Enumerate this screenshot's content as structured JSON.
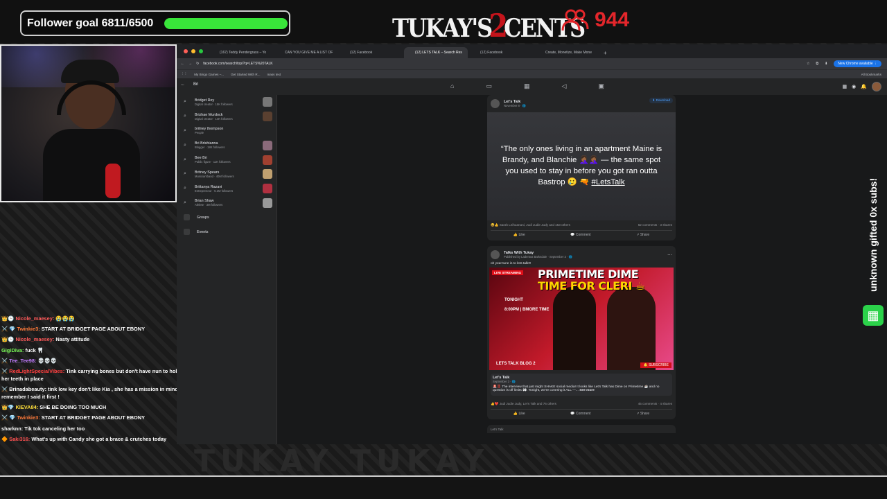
{
  "overlay": {
    "follower_goal_label": "Follower goal 6811/6500",
    "follower_goal_progress": 1.0,
    "logo_part1": "TUKAY'S",
    "logo_two": "2",
    "logo_part2": "CENTS",
    "viewer_count": "944",
    "alert_text": "unknown gifted 0x subs!",
    "bottom_text": "TUKAY TUKAY"
  },
  "chat": [
    {
      "badges": "👑🕒",
      "user": "Nicole_maesey:",
      "user_color": "#ff5a5a",
      "message": "😭😭😭"
    },
    {
      "badges": "⚔️ 💎",
      "user": "Twinkie3:",
      "user_color": "#ff7a3a",
      "message": "START AT BRIDGET PAGE ABOUT EBONY"
    },
    {
      "badges": "👑🕒",
      "user": "Nicole_maesey:",
      "user_color": "#ff5a5a",
      "message": "Nasty attitude"
    },
    {
      "badges": "",
      "user": "GigiDiva:",
      "user_color": "#7cff5a",
      "message": "fuck 🦷"
    },
    {
      "badges": "⚔️",
      "user": "Tee_Tee98:",
      "user_color": "#c07cff",
      "message": "💀💀💀"
    },
    {
      "badges": "⚔️",
      "user": "RedLightSpecialVibes:",
      "user_color": "#ff4040",
      "message": "Tink carrying bones but don't have nun to hold her teeth in place"
    },
    {
      "badges": "⚔️",
      "user": "Brinadabeauty:",
      "user_color": "#ffffff",
      "message": "tink low key don't like Kia , she has a mission in mind , remember I said it first !"
    },
    {
      "badges": "👑💎",
      "user": "KIEVA84:",
      "user_color": "#ffdf3a",
      "message": "SHE BE DOING TOO MUCH"
    },
    {
      "badges": "⚔️ 💎",
      "user": "Twinkie3:",
      "user_color": "#ff7a3a",
      "message": "START AT BRIDGET PAGE ABOUT EBONY"
    },
    {
      "badges": "",
      "user": "sharknn:",
      "user_color": "#ffffff",
      "message": "Tik tok canceling her too"
    },
    {
      "badges": "🔶",
      "user": "Saki316:",
      "user_color": "#ff5050",
      "message": "What's up with Candy she got a brace & crutches today"
    }
  ],
  "browser": {
    "tabs": [
      {
        "label": "(167) Teddy Pendergrass – Yo",
        "active": false
      },
      {
        "label": "CAN YOU GIVE ME A LIST OF",
        "active": false
      },
      {
        "label": "(12) Facebook",
        "active": false
      },
      {
        "label": "(12) LETS TALK – Search Res",
        "active": true
      },
      {
        "label": "(12) Facebook",
        "active": false
      },
      {
        "label": "Create, Monetize, Make Mone",
        "active": false
      }
    ],
    "tab_plus": "+",
    "url": "facebook.com/search/top/?q=LETS%20TALK",
    "new_chrome": "New Chrome available ⋮",
    "bookmarks": [
      "My Bingo Games –...",
      "Get Started With R...",
      "mass text"
    ],
    "all_bookmarks": "All Bookmarks"
  },
  "fb": {
    "search_back": "←",
    "search_query": "Bri",
    "suggestions": [
      {
        "name": "Bridget Rey",
        "sub": "Digital creator · 15K followers",
        "thumb": "#777"
      },
      {
        "name": "Brizhae Murdock",
        "sub": "Digital creator · 14K followers",
        "thumb": "#5a4030"
      },
      {
        "name": "britney thompson",
        "sub": "People",
        "thumb": ""
      },
      {
        "name": "Bri Bri̇shianna",
        "sub": "Blogger · 18K followers",
        "thumb": "#8a6a7a"
      },
      {
        "name": "Bee Bri",
        "sub": "Public figure · 11K followers",
        "thumb": "#a04030"
      },
      {
        "name": "Britney Spears",
        "sub": "Musician/band · 40M followers",
        "thumb": "#c0a070"
      },
      {
        "name": "Brittanya Razavi",
        "sub": "Entrepreneur · 5.1M followers",
        "thumb": "#b03040"
      },
      {
        "name": "Brian Shaw",
        "sub": "Athlete · 3M followers",
        "thumb": "#999"
      }
    ],
    "side_links": [
      "Groups",
      "Events"
    ],
    "post1": {
      "author": "Let's Talk",
      "meta": "November 8 · 🌐",
      "download": "⬇ Download",
      "quote": "“The only ones living in an apartment Maine is Brandy, and Blanchie 🤦🏾‍♀️🤦🏾‍♀️ — the same spot you used to stay in before you got ran outta Bastrop 🥲 🔫",
      "hashtag": "#LetsTalk",
      "reactions": "😆👍 Sarah Leihuanani, Judi Judie Judy and 153 others",
      "counts": "62 comments · 3 shares",
      "like": "👍 Like",
      "comment": "💬 Comment",
      "share": "↗ Share"
    },
    "post2": {
      "author": "Talks With Tukay",
      "meta": "Published by Ladentus Barksdale · September 3 · 🌐",
      "text": "oh yea! tune in to lets talk!!!",
      "live": "LIVE STREAMING",
      "title1": "PRIMETIME DIME",
      "title2": "TIME FOR CLERI ☕",
      "tonight": "TONIGHT",
      "time": "8:00PM | BMORE TIME",
      "subscribe": "🔔 SUBSCRIBE",
      "blog": "LETS TALK BLOG 2",
      "shared_author": "Let's Talk",
      "shared_meta": "September 3 · 🌐",
      "shared_text": "🚨‼️ The interview that just might SHAKE social media! It looks like Let's Talk has Dime on Primetime ☕ and no question is off limits 👀. Tonight, we're covering it ALL —...",
      "see_more": "See more",
      "reactions": "👍❤️ Judi Judie Judy, Let's Talk and 76 others",
      "counts": "45 comments · 4 shares",
      "like": "👍 Like",
      "comment": "💬 Comment",
      "share": "↗ Share"
    },
    "post3_author": "Let's Talk"
  }
}
